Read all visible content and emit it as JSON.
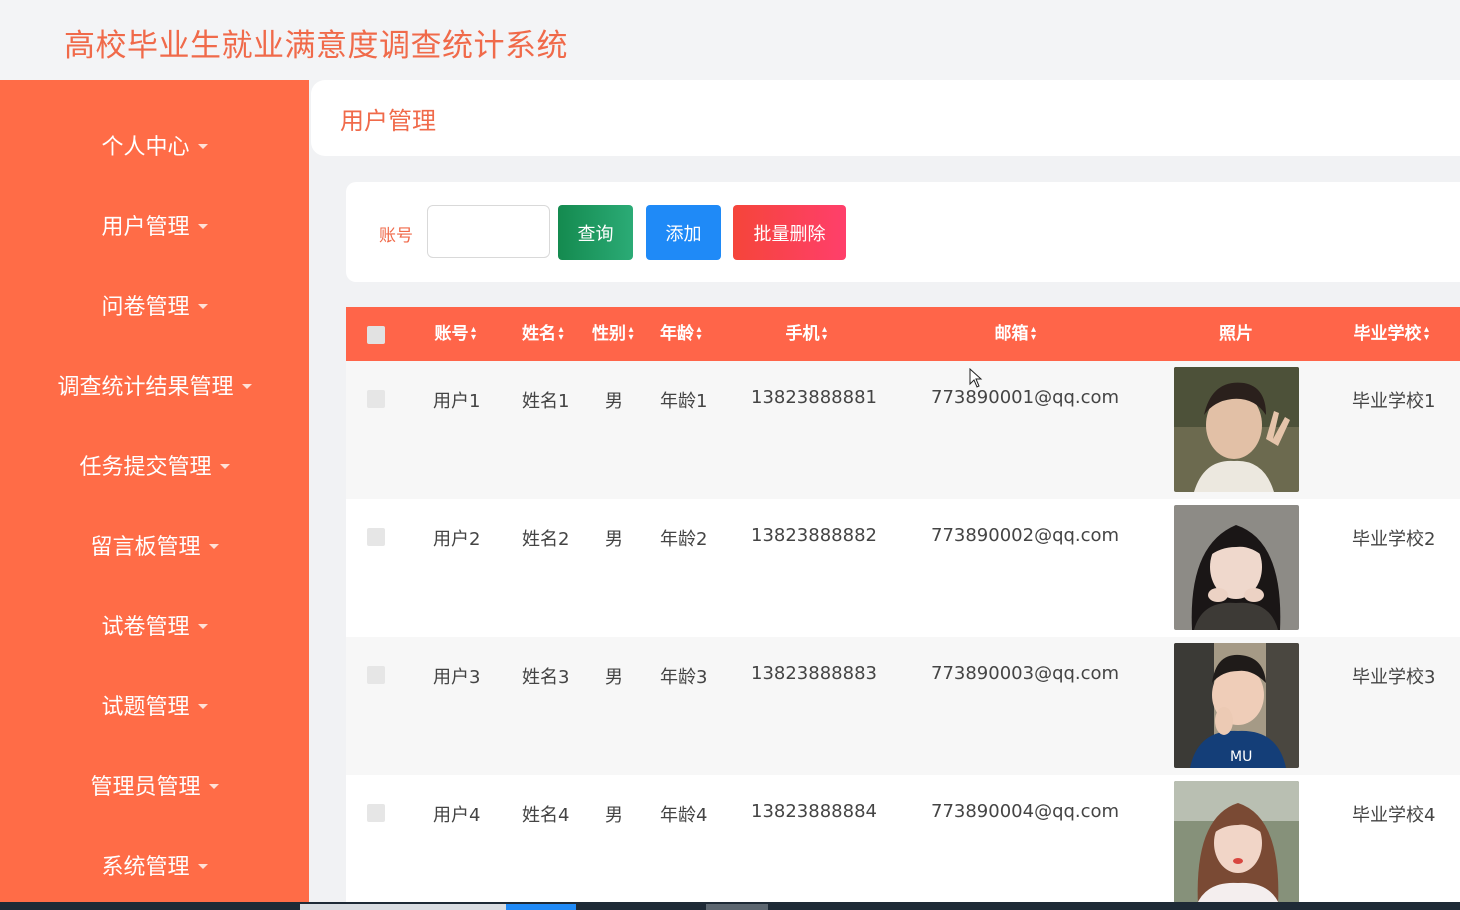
{
  "app": {
    "title": "高校毕业生就业满意度调查统计系统"
  },
  "sidebar": {
    "items": [
      {
        "label": "个人中心"
      },
      {
        "label": "用户管理"
      },
      {
        "label": "问卷管理"
      },
      {
        "label": "调查统计结果管理"
      },
      {
        "label": "任务提交管理"
      },
      {
        "label": "留言板管理"
      },
      {
        "label": "试卷管理"
      },
      {
        "label": "试题管理"
      },
      {
        "label": "管理员管理"
      },
      {
        "label": "系统管理"
      }
    ]
  },
  "breadcrumb": {
    "title": "用户管理"
  },
  "search": {
    "label": "账号",
    "value": "",
    "query_button": "查询",
    "add_button": "添加",
    "batch_delete_button": "批量删除"
  },
  "table": {
    "columns": [
      "账号",
      "姓名",
      "性别",
      "年龄",
      "手机",
      "邮箱",
      "照片",
      "毕业学校"
    ],
    "rows": [
      {
        "account": "用户1",
        "name": "姓名1",
        "gender": "男",
        "age": "年龄1",
        "phone": "13823888881",
        "email": "773890001@qq.com",
        "school": "毕业学校1"
      },
      {
        "account": "用户2",
        "name": "姓名2",
        "gender": "男",
        "age": "年龄2",
        "phone": "13823888882",
        "email": "773890002@qq.com",
        "school": "毕业学校2"
      },
      {
        "account": "用户3",
        "name": "姓名3",
        "gender": "男",
        "age": "年龄3",
        "phone": "13823888883",
        "email": "773890003@qq.com",
        "school": "毕业学校3"
      },
      {
        "account": "用户4",
        "name": "姓名4",
        "gender": "男",
        "age": "年龄4",
        "phone": "13823888884",
        "email": "773890004@qq.com",
        "school": "毕业学校4"
      }
    ]
  },
  "colors": {
    "accent": "#ff6c47",
    "title": "#f06a4a",
    "header": "#ff6549",
    "query": "#1a9a5e",
    "add": "#1f8af7",
    "delete": "#f5453a"
  },
  "icons": {
    "sort": "sort-icon",
    "caret": "chevron-down-icon",
    "photo": "user-photo",
    "cursor": "mouse-cursor-icon"
  }
}
